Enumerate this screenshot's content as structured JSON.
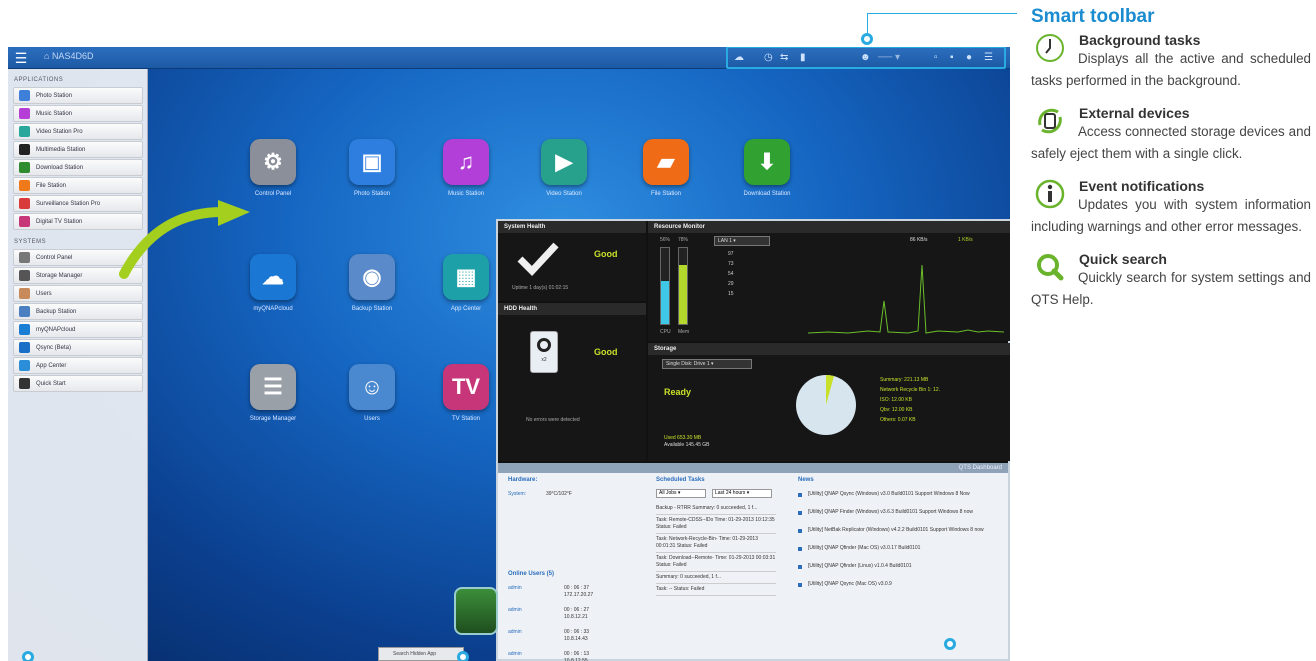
{
  "screen": {
    "home_label": "NAS4D6D",
    "sidebar": {
      "applications_header": "APPLICATIONS",
      "apps": [
        {
          "label": "Photo Station",
          "color": "#3d7fd9"
        },
        {
          "label": "Music Station",
          "color": "#b53fd6"
        },
        {
          "label": "Video Station Pro",
          "color": "#2aa79b"
        },
        {
          "label": "Multimedia Station",
          "color": "#222222"
        },
        {
          "label": "Download Station",
          "color": "#2e8b2e"
        },
        {
          "label": "File Station",
          "color": "#f07a1a"
        },
        {
          "label": "Surveillance Station Pro",
          "color": "#d93b3b"
        },
        {
          "label": "Digital TV Station",
          "color": "#c8367a"
        }
      ],
      "systems_header": "SYSTEMS",
      "systems": [
        {
          "label": "Control Panel",
          "color": "#777777"
        },
        {
          "label": "Storage Manager",
          "color": "#555555"
        },
        {
          "label": "Users",
          "color": "#c88a5a"
        },
        {
          "label": "Backup Station",
          "color": "#4a7fc1"
        },
        {
          "label": "myQNAPcloud",
          "color": "#1a7fd4"
        },
        {
          "label": "Qsync (Beta)",
          "color": "#1c6fc7"
        },
        {
          "label": "App Center",
          "color": "#2a8fd8"
        },
        {
          "label": "Quick Start",
          "color": "#333333"
        }
      ]
    },
    "desktop_apps": [
      {
        "label": "Control Panel",
        "glyph": "⚙",
        "color": "#8a8f99"
      },
      {
        "label": "Photo Station",
        "glyph": "▣",
        "color": "#2e7ee0"
      },
      {
        "label": "Music Station",
        "glyph": "♫",
        "color": "#b23fd8"
      },
      {
        "label": "Video Station",
        "glyph": "▶",
        "color": "#27a08c"
      },
      {
        "label": "File Station",
        "glyph": "▰",
        "color": "#f06b16"
      },
      {
        "label": "Download Station",
        "glyph": "⬇",
        "color": "#31a132"
      },
      {
        "label": "myQNAPcloud",
        "glyph": "☁",
        "color": "#1a78d4"
      },
      {
        "label": "Backup Station",
        "glyph": "◉",
        "color": "#5a8ac9"
      },
      {
        "label": "App Center",
        "glyph": "▦",
        "color": "#1da0a8"
      },
      {
        "label": "Storage Manager",
        "glyph": "☰",
        "color": "#9aa0a8"
      },
      {
        "label": "Users",
        "glyph": "☺",
        "color": "#4a88d0"
      },
      {
        "label": "TV Station",
        "glyph": "TV",
        "color": "#c8367a"
      }
    ],
    "dashboard": {
      "system_health": {
        "title": "System Health",
        "status": "Good",
        "uptime": "Uptime 1 day(s) 01:02:15"
      },
      "resource_monitor": {
        "title": "Resource Monitor",
        "cpu_label": "CPU",
        "mem_label": "Mem",
        "cpu_pct": "56%",
        "mem_pct": "78%",
        "lan": "LAN 1",
        "rx": "86 KB/s",
        "tx": "1 KB/s",
        "scale": [
          "97",
          "73",
          "54",
          "29",
          "15"
        ]
      },
      "hdd_health": {
        "title": "HDD Health",
        "status": "Good",
        "drive_count": "x2",
        "note": "No errors were detected"
      },
      "storage": {
        "title": "Storage",
        "disk": "Single Disk: Drive 1",
        "state": "Ready",
        "used": "Used 653.30 MB",
        "available": "Available 145.45 GB",
        "legend": [
          "Summary: 221.13 MB",
          "Network Recycle Bin 1: 12.",
          "ISO: 12.00 KB",
          "Qbv: 12.00 KB",
          "Others: 0.07 KB"
        ]
      },
      "brand": "QTS Dashboard",
      "hardware": {
        "title": "Hardware:",
        "label": "System:",
        "value": "39°C/102°F"
      },
      "online_users": {
        "title": "Online Users (5)",
        "rows": [
          {
            "user": "admin",
            "time": "00 : 06 : 37",
            "ip": "172.17.20.27"
          },
          {
            "user": "admin",
            "time": "00 : 06 : 27",
            "ip": "10.8.12.21"
          },
          {
            "user": "admin",
            "time": "00 : 06 : 33",
            "ip": "10.8.14.43"
          },
          {
            "user": "admin",
            "time": "00 : 06 : 13",
            "ip": "10.8.12.55"
          }
        ]
      },
      "scheduled": {
        "title": "Scheduled Tasks",
        "filter1": "All Jobs",
        "filter2": "Last 24 hours",
        "tasks": [
          "Backup - RTRR  Summary: 0 succeeded, 1 f...",
          "Task: Remote-CDSS--IDo  Time: 01-29-2013 10:12:35  Status: Failed",
          "Task: Network-Recycle-Bin-  Time: 01-29-2013 00:01:31  Status: Failed",
          "Task: Download--Remote-  Time: 01-29-2013 00:03:31  Status: Failed",
          "Summary: 0 succeeded, 1 f...",
          "Task: --  Status: Failed"
        ]
      },
      "news": {
        "title": "News",
        "items": [
          "[Utility] QNAP Qsync (Windows) v3.0  Build0101 Support Windows 8 Now",
          "[Utility] QNAP Finder (Windows) v3.6.3  Build0101 Support Windows 8 now",
          "[Utility] NetBak Replicator (Windows) v4.2.2  Build0101 Support Windows 8 now",
          "[Utility] QNAP Qfinder (Mac OS) v3.0.17  Build0101",
          "[Utility] QNAP Qfinder (Linux) v1.0.4  Build0101",
          "[Utility] QNAP Qsync (Mac OS) v3.0.9"
        ]
      }
    },
    "search_placeholder": "Search Hidden App"
  },
  "info": {
    "toolbar_title": "Smart toolbar",
    "features": [
      {
        "icon": "clock-icon",
        "title": "Background tasks",
        "desc": "Displays all the active and scheduled tasks performed in the background."
      },
      {
        "icon": "external-devices-icon",
        "title": "External devices",
        "desc": "Access connected storage devices and safely eject them with a single click."
      },
      {
        "icon": "info-icon",
        "title": "Event notifications",
        "desc": "Updates you with system information including warnings and other error messages."
      },
      {
        "icon": "search-icon",
        "title": "Quick search",
        "desc": "Quickly search for system settings and QTS Help."
      }
    ]
  },
  "colors": {
    "accent": "#29aae1",
    "title_blue": "#1a8ccf",
    "icon_green": "#6ab42d"
  }
}
